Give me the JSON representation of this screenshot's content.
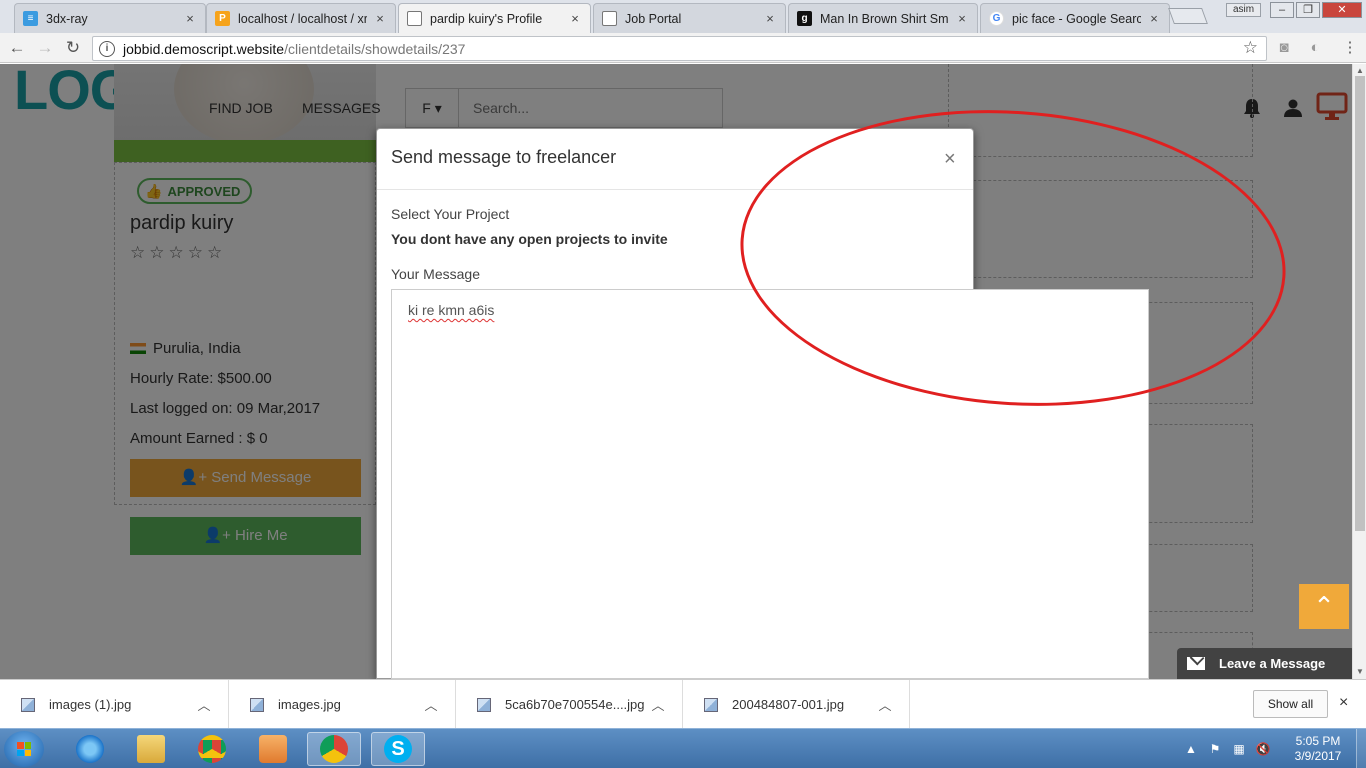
{
  "browser": {
    "tabs": [
      {
        "title": "3dx-ray",
        "close": "×"
      },
      {
        "title": "localhost / localhost / xra",
        "close": "×"
      },
      {
        "title": "pardip kuiry's Profile",
        "close": "×"
      },
      {
        "title": "Job Portal",
        "close": "×"
      },
      {
        "title": "Man In Brown Shirt Smili",
        "close": "×"
      },
      {
        "title": "pic face - Google Search",
        "close": "×"
      }
    ],
    "user_badge": "asim",
    "url_host": "jobbid.demoscript.website",
    "url_path": "/clientdetails/showdetails/237"
  },
  "header": {
    "logo": "LOGO",
    "nav": [
      "FIND JOB",
      "MESSAGES"
    ],
    "search_dropdown": "F ▾",
    "search_placeholder": "Search..."
  },
  "profile": {
    "badge": "APPROVED",
    "name": "pardip kuiry",
    "stars": "☆☆☆☆☆",
    "location": "Purulia, India",
    "hourly_rate": "Hourly Rate: $500.00",
    "last_logged": "Last logged on: 09 Mar,2017",
    "amount_earned": "Amount Earned : $ 0",
    "send_message": "Send Message",
    "hire_me": "Hire Me"
  },
  "modal": {
    "title": "Send message to freelancer",
    "close": "×",
    "project_label": "Select Your Project",
    "project_notice": "You dont have any open projects to invite",
    "message_label": "Your Message",
    "message_value": "ki re kmn a6is"
  },
  "widgets": {
    "leave_message": "Leave a Message",
    "scroll_top": "⌃"
  },
  "downloads": {
    "items": [
      {
        "name": "images (1).jpg"
      },
      {
        "name": "images.jpg"
      },
      {
        "name": "5ca6b70e700554e....jpg"
      },
      {
        "name": "200484807-001.jpg"
      }
    ],
    "show_all": "Show all",
    "close": "×"
  },
  "taskbar": {
    "time": "5:05 PM",
    "date": "3/9/2017"
  },
  "colors": {
    "brand_teal": "#1aa0a6",
    "approved_green": "#5cb85c",
    "send_orange": "#f0a93a",
    "annotation_red": "#e02020"
  }
}
